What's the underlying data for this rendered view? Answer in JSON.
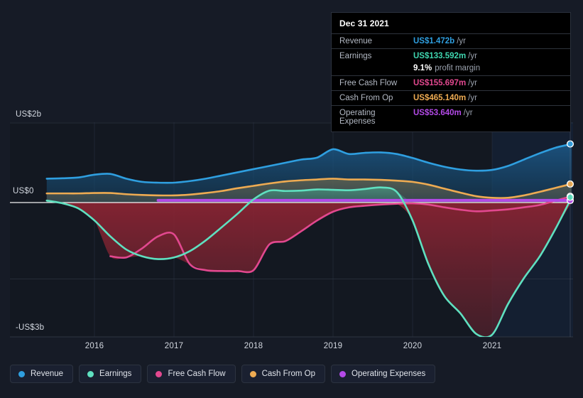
{
  "colors": {
    "background": "#161b26",
    "plot_background": "#131821",
    "forecast_background": "#141d2e",
    "gridline": "#333a47",
    "zero_line": "#ffffff",
    "revenue": "#2f9fe0",
    "earnings": "#5fe0c0",
    "free_cash_flow": "#e2488f",
    "cash_from_op": "#eeab52",
    "operating_expenses": "#b44ae8",
    "negative_fill": "#7e2230"
  },
  "tooltip": {
    "title": "Dec 31 2021",
    "rows": [
      {
        "key": "Revenue",
        "value": "US$1.472b",
        "unit": "/yr",
        "color": "#2f9fe0"
      },
      {
        "key": "Earnings",
        "value": "US$133.592m",
        "unit": "/yr",
        "color": "#3fd6b0"
      },
      {
        "key": "Free Cash Flow",
        "value": "US$155.697m",
        "unit": "/yr",
        "color": "#e2488f"
      },
      {
        "key": "Cash From Op",
        "value": "US$465.140m",
        "unit": "/yr",
        "color": "#eeab52"
      },
      {
        "key": "Operating Expenses",
        "value": "US$53.640m",
        "unit": "/yr",
        "color": "#b44ae8"
      }
    ],
    "profit_margin_value": "9.1%",
    "profit_margin_label": "profit margin"
  },
  "legend": {
    "items": [
      {
        "label": "Revenue",
        "color": "#2f9fe0"
      },
      {
        "label": "Earnings",
        "color": "#5fe0c0"
      },
      {
        "label": "Free Cash Flow",
        "color": "#e2488f"
      },
      {
        "label": "Cash From Op",
        "color": "#eeab52"
      },
      {
        "label": "Operating Expenses",
        "color": "#b44ae8"
      }
    ]
  },
  "axes": {
    "y_top_label": "US$2b",
    "y_zero_label": "US$0",
    "y_bottom_label": "-US$3b",
    "x_labels": [
      "2016",
      "2017",
      "2018",
      "2019",
      "2020",
      "2021"
    ]
  },
  "chart_data": {
    "type": "area",
    "title": "",
    "xlabel": "",
    "ylabel": "US$",
    "ylim": [
      -3.6,
      2.0
    ],
    "y_ticks": [
      2.0,
      0.0,
      -1.93
    ],
    "y_tick_labels": [
      "US$2b",
      "US$0",
      "-US$3b"
    ],
    "x_ticks": [
      "2016",
      "2017",
      "2018",
      "2019",
      "2020",
      "2021"
    ],
    "grid": true,
    "legend_position": "bottom",
    "units": "billions USD per year",
    "forecast_start": "2021",
    "x": [
      "2015.4",
      "2015.6",
      "2015.8",
      "2016.0",
      "2016.2",
      "2016.4",
      "2016.6",
      "2016.8",
      "2017.0",
      "2017.2",
      "2017.4",
      "2017.6",
      "2017.8",
      "2018.0",
      "2018.2",
      "2018.4",
      "2018.6",
      "2018.8",
      "2019.0",
      "2019.2",
      "2019.4",
      "2019.6",
      "2019.8",
      "2020.0",
      "2020.2",
      "2020.4",
      "2020.6",
      "2020.8",
      "2021.0",
      "2021.2",
      "2021.4",
      "2021.6",
      "2021.8",
      "2022.0"
    ],
    "series": [
      {
        "name": "Revenue",
        "color": "#2f9fe0",
        "values": [
          0.6,
          0.61,
          0.63,
          0.7,
          0.72,
          0.6,
          0.52,
          0.5,
          0.5,
          0.54,
          0.6,
          0.68,
          0.76,
          0.84,
          0.92,
          1.0,
          1.08,
          1.13,
          1.34,
          1.22,
          1.25,
          1.26,
          1.22,
          1.12,
          1.0,
          0.9,
          0.83,
          0.8,
          0.82,
          0.92,
          1.08,
          1.24,
          1.38,
          1.47
        ]
      },
      {
        "name": "Earnings",
        "color": "#5fe0c0",
        "values": [
          0.05,
          -0.02,
          -0.15,
          -0.45,
          -0.85,
          -1.18,
          -1.35,
          -1.42,
          -1.38,
          -1.22,
          -0.95,
          -0.62,
          -0.28,
          0.08,
          0.3,
          0.29,
          0.3,
          0.33,
          0.32,
          0.31,
          0.34,
          0.38,
          0.27,
          -0.45,
          -1.55,
          -2.35,
          -2.78,
          -3.3,
          -3.32,
          -2.55,
          -1.9,
          -1.35,
          -0.65,
          0.13
        ]
      },
      {
        "name": "Free Cash Flow",
        "color": "#e2488f",
        "values": [
          null,
          null,
          null,
          null,
          -1.35,
          -1.38,
          -1.15,
          -0.85,
          -0.8,
          -1.55,
          -1.7,
          -1.72,
          -1.72,
          -1.7,
          -1.05,
          -0.97,
          -0.72,
          -0.45,
          -0.23,
          -0.12,
          -0.08,
          -0.05,
          -0.03,
          -0.02,
          -0.05,
          -0.12,
          -0.18,
          -0.22,
          -0.2,
          -0.17,
          -0.12,
          -0.06,
          0.05,
          0.16
        ]
      },
      {
        "name": "Cash From Op",
        "color": "#eeab52",
        "values": [
          0.23,
          0.23,
          0.23,
          0.24,
          0.24,
          0.21,
          0.19,
          0.18,
          0.18,
          0.2,
          0.24,
          0.29,
          0.36,
          0.42,
          0.48,
          0.53,
          0.56,
          0.58,
          0.6,
          0.58,
          0.58,
          0.57,
          0.55,
          0.52,
          0.45,
          0.35,
          0.25,
          0.16,
          0.12,
          0.12,
          0.18,
          0.27,
          0.37,
          0.47
        ]
      },
      {
        "name": "Operating Expenses",
        "color": "#b44ae8",
        "values": [
          null,
          null,
          null,
          null,
          null,
          null,
          null,
          0.055,
          0.055,
          0.055,
          0.055,
          0.055,
          0.055,
          0.055,
          0.055,
          0.055,
          0.055,
          0.055,
          0.055,
          0.055,
          0.055,
          0.055,
          0.055,
          0.055,
          0.055,
          0.055,
          0.055,
          0.055,
          0.055,
          0.055,
          0.055,
          0.055,
          0.055,
          0.054
        ]
      }
    ],
    "end_markers": [
      {
        "name": "Revenue",
        "value": 1.472,
        "color": "#2f9fe0"
      },
      {
        "name": "Cash From Op",
        "value": 0.465,
        "color": "#eeab52"
      },
      {
        "name": "Operating Expenses",
        "value": 0.054,
        "color": "#b44ae8"
      },
      {
        "name": "Free Cash Flow",
        "value": 0.156,
        "color": "#e2488f"
      },
      {
        "name": "Earnings",
        "value": 0.134,
        "color": "#5fe0c0"
      }
    ]
  }
}
